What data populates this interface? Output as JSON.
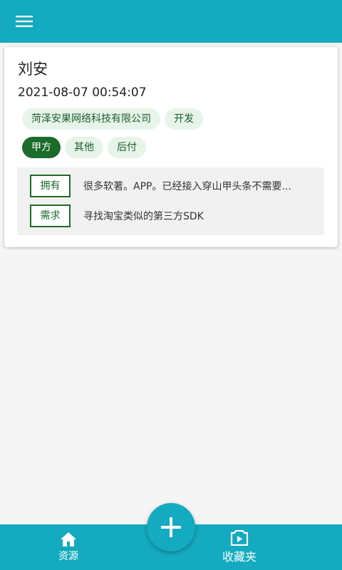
{
  "colors": {
    "primary": "#14aabf",
    "chip_bg": "#e6f4ea",
    "chip_active": "#1b6b2b",
    "info_bg": "#f1f1f1"
  },
  "header": {
    "menu_icon": "hamburger-menu-icon"
  },
  "card": {
    "name": "刘安",
    "time": "2021-08-07 00:54:07",
    "company_tags": [
      "菏泽安果网络科技有限公司",
      "开发"
    ],
    "status_tags": [
      {
        "label": "甲方",
        "active": true
      },
      {
        "label": "其他",
        "active": false
      },
      {
        "label": "后付",
        "active": false
      }
    ],
    "have_label": "拥有",
    "have_text": "很多软著。APP。已经接入穿山甲头条不需要...",
    "need_label": "需求",
    "need_text": "寻找淘宝类似的第三方SDK"
  },
  "bottom_nav": {
    "resources_label": "资源",
    "resources_icon": "home-icon",
    "favorites_label": "收藏夹",
    "favorites_icon": "video-folder-icon"
  },
  "fab": {
    "icon": "plus-icon"
  }
}
